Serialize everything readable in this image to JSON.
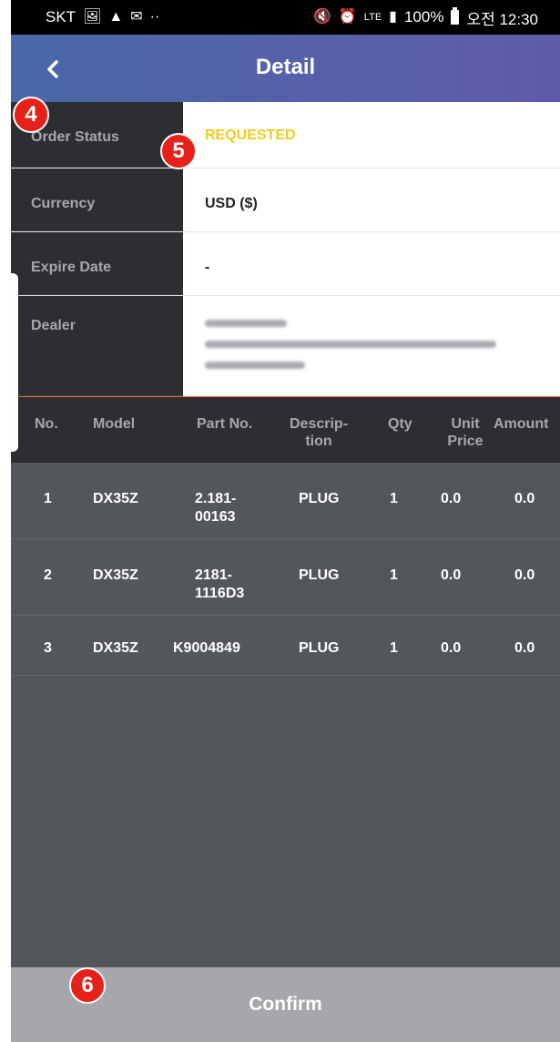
{
  "status_bar": {
    "carrier": "SKT",
    "right_text": "100%",
    "time": "오전 12:30",
    "network": "LTE"
  },
  "header": {
    "title": "Detail"
  },
  "info": {
    "order_status_label": "Order Status",
    "order_status_value": "REQUESTED",
    "currency_label": "Currency",
    "currency_value": "USD ($)",
    "expire_label": "Expire Date",
    "expire_value": "-",
    "dealer_label": "Dealer"
  },
  "columns": {
    "no": "No.",
    "model": "Model",
    "part": "Part No.",
    "desc": "Descrip-\ntion",
    "qty": "Qty",
    "unit": "Unit\nPrice",
    "amount": "Amount"
  },
  "rows": [
    {
      "no": "1",
      "model": "DX35Z",
      "part": "2.181-\n00163",
      "desc": "PLUG",
      "qty": "1",
      "unit": "0.0",
      "amount": "0.0"
    },
    {
      "no": "2",
      "model": "DX35Z",
      "part": "2181-\n1116D3",
      "desc": "PLUG",
      "qty": "1",
      "unit": "0.0",
      "amount": "0.0"
    },
    {
      "no": "3",
      "model": "DX35Z",
      "part": "K9004849",
      "desc": "PLUG",
      "qty": "1",
      "unit": "0.0",
      "amount": "0.0"
    }
  ],
  "confirm_label": "Confirm",
  "badges": {
    "b4": "4",
    "b5": "5",
    "b6": "6"
  },
  "colors": {
    "header_start": "#4a68a8",
    "header_end": "#5f5aa8",
    "status_text": "#f2cc1f",
    "divider": "#f06a25",
    "badge": "#e8201a"
  }
}
